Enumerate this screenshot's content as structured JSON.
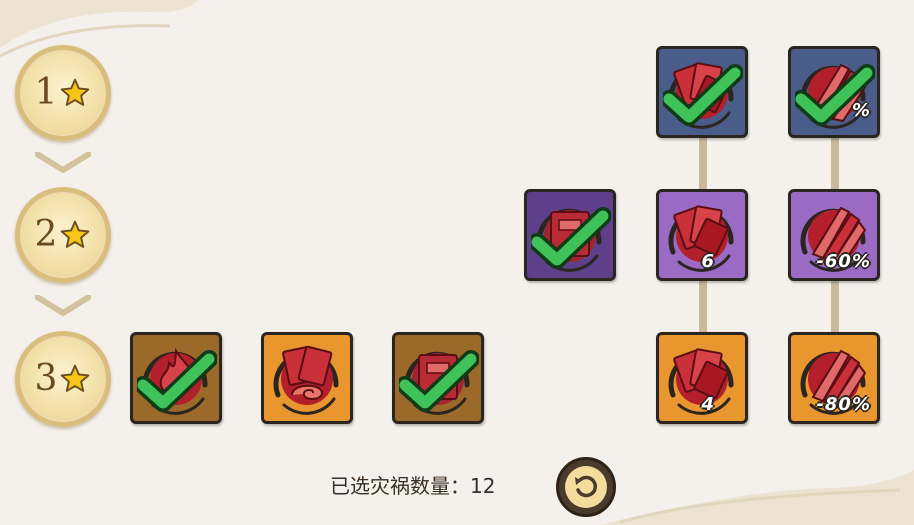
{
  "tiers": [
    {
      "label": "1",
      "star_icon": "star-icon"
    },
    {
      "label": "2",
      "star_icon": "star-icon"
    },
    {
      "label": "3",
      "star_icon": "star-icon"
    }
  ],
  "cards": {
    "t1_hand_blue": {
      "value": "",
      "selected": true,
      "color": "#4a5c8a",
      "icon": "red-cards-icon"
    },
    "t1_claw_blue": {
      "value": "%",
      "selected": true,
      "color": "#4a5c8a",
      "icon": "claw-slash-icon"
    },
    "t2_book_purple": {
      "value": "",
      "selected": true,
      "color": "#5e3f8a",
      "icon": "book-icon"
    },
    "t2_hand_purple": {
      "value": "6",
      "selected": false,
      "color": "#9a6ac4",
      "icon": "red-cards-icon"
    },
    "t2_claw_purple": {
      "value": "-60%",
      "selected": false,
      "color": "#9a6ac4",
      "icon": "claw-slash-icon"
    },
    "t3_flame_brown": {
      "value": "",
      "selected": true,
      "color": "#9b6a2a",
      "icon": "flame-icon"
    },
    "t3_swirl_orange": {
      "value": "",
      "selected": false,
      "color": "#e9962f",
      "icon": "swirl-cards-icon"
    },
    "t3_book_brown": {
      "value": "",
      "selected": true,
      "color": "#9b6a2a",
      "icon": "book-icon"
    },
    "t3_hand_orange": {
      "value": "4",
      "selected": false,
      "color": "#e9962f",
      "icon": "red-cards-icon"
    },
    "t3_claw_orange": {
      "value": "-80%",
      "selected": false,
      "color": "#e9962f",
      "icon": "claw-slash-icon"
    }
  },
  "footer": {
    "count_label": "已选灾祸数量：",
    "count_value": "12",
    "reset_icon": "reset-icon"
  }
}
